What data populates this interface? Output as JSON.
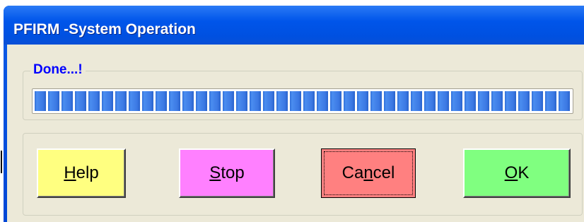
{
  "window": {
    "title": "PFIRM -System Operation"
  },
  "status": {
    "label": "Done...!",
    "progress_percent": 100
  },
  "buttons": {
    "help": {
      "pre": "",
      "mnemonic": "H",
      "post": "elp"
    },
    "stop": {
      "pre": "",
      "mnemonic": "S",
      "post": "top"
    },
    "cancel": {
      "pre": "Ca",
      "mnemonic": "n",
      "post": "cel"
    },
    "ok": {
      "pre": "",
      "mnemonic": "O",
      "post": "K"
    }
  },
  "colors": {
    "title_bar": "#0055ea",
    "status_text": "#0000ff",
    "progress": "#3b78e3",
    "help_button": "#ffff80",
    "stop_button": "#ff80ff",
    "cancel_button": "#ff8080",
    "ok_button": "#80ff80"
  }
}
